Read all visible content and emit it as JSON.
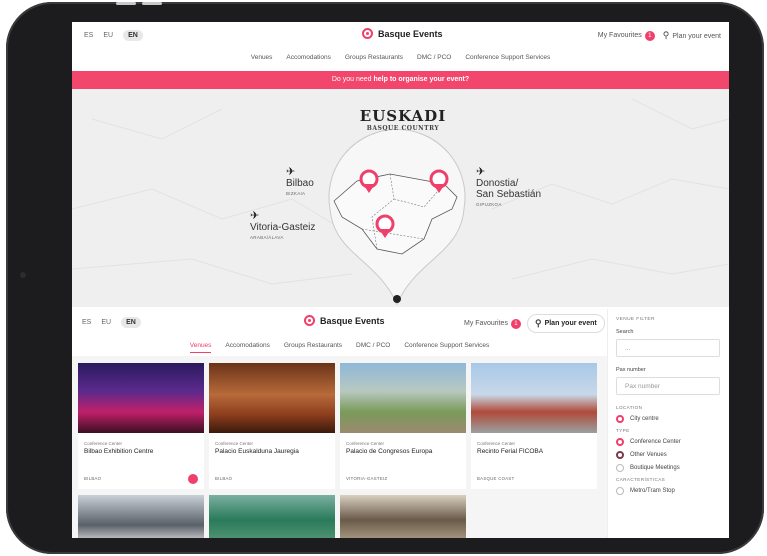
{
  "header": {
    "languages": [
      "ES",
      "EU",
      "EN"
    ],
    "active_language": "EN",
    "brand": "Basque Events",
    "favourites_label": "My Favourites",
    "favourites_count": "1",
    "plan_label": "Plan your event"
  },
  "nav": [
    "Venues",
    "Accomodations",
    "Groups Restaurants",
    "DMC / PCO",
    "Conference Support Services"
  ],
  "banner": {
    "prefix": "Do you need",
    "strong": "help to organise your event?"
  },
  "map": {
    "title": "EUSKADI",
    "subtitle": "BASQUE COUNTRY",
    "cities": [
      {
        "name": "Bilbao",
        "sub": "BIZKAIA"
      },
      {
        "name": "Donostia/",
        "name2": "San Sebastián",
        "sub": "GIPUZKOA"
      },
      {
        "name": "Vitoria-Gasteiz",
        "sub": "ARABA/ÁLAVA"
      }
    ]
  },
  "sub_header": {
    "languages": [
      "ES",
      "EU",
      "EN"
    ],
    "brand": "Basque Events",
    "favourites_label": "My Favourites",
    "favourites_count": "1",
    "plan_label": "Plan your event"
  },
  "sub_nav": [
    "Venues",
    "Accomodations",
    "Groups Restaurants",
    "DMC / PCO",
    "Conference Support Services"
  ],
  "cards": [
    {
      "category": "Conference Center",
      "title": "Bilbao Exhibition Centre",
      "location": "BILBAO",
      "favourite": true
    },
    {
      "category": "Conference Center",
      "title": "Palacio Euskalduna Jauregia",
      "location": "BILBAO",
      "favourite": false
    },
    {
      "category": "Conference Center",
      "title": "Palacio de Congresos Europa",
      "location": "VITORIA-GASTEIZ",
      "favourite": false
    },
    {
      "category": "Conference Center",
      "title": "Recinto Ferial FICOBA",
      "location": "BASQUE COAST",
      "favourite": false
    }
  ],
  "filter": {
    "title": "VENUE FILTER",
    "search_label": "Search",
    "search_placeholder": "...",
    "pax_label": "Pax number",
    "pax_placeholder": "Pax number",
    "location_heading": "LOCATION",
    "location_options": [
      "City centre"
    ],
    "type_heading": "TYPE",
    "type_options": [
      "Conference Center",
      "Other Venues",
      "Boutique Meetings"
    ],
    "characteristics_heading": "CARACTERÍSTICAS",
    "characteristics_options": [
      "Metro/Tram Stop"
    ]
  },
  "colors": {
    "accent": "#ef3f6a",
    "banner": "#f2466c"
  }
}
